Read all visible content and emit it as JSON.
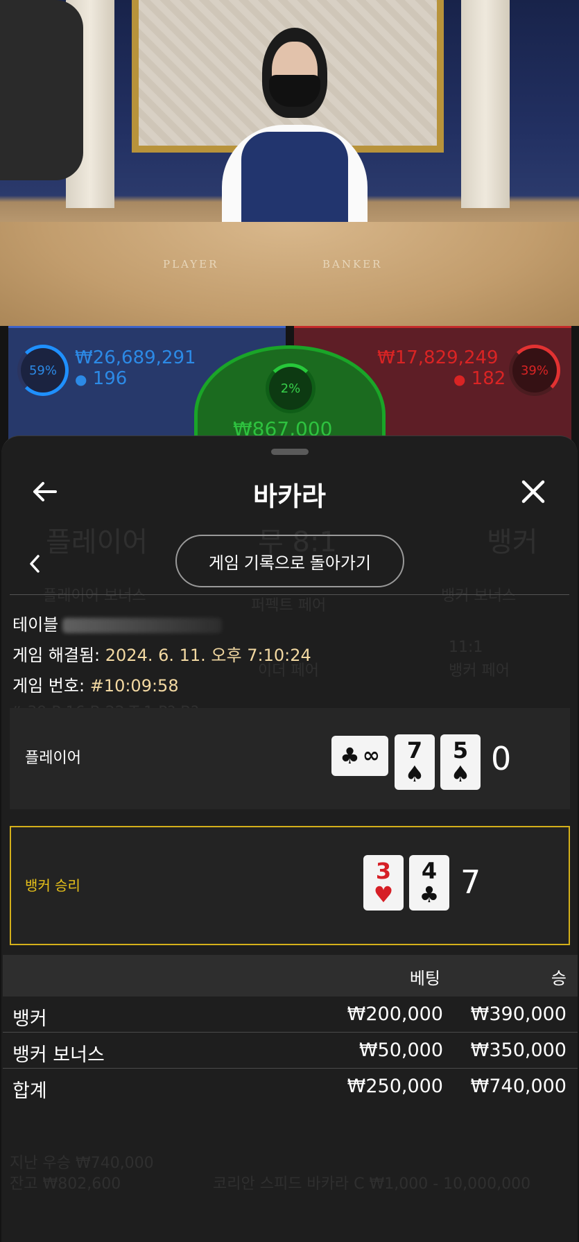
{
  "betting_strip": {
    "player": {
      "percent": "59%",
      "amount": "₩26,689,291",
      "players": "196"
    },
    "banker": {
      "percent": "39%",
      "amount": "₩17,829,249",
      "players": "182"
    },
    "tie": {
      "percent": "2%",
      "amount": "₩867,000"
    },
    "table_labels": {
      "player": "PLAYER",
      "banker": "BANKER"
    }
  },
  "header": {
    "title": "바카라",
    "back_icon": "arrow-left-icon",
    "close_icon": "close-icon"
  },
  "nav": {
    "prev_icon": "chevron-left-icon",
    "back_to_history_label": "게임 기록으로 돌아가기"
  },
  "game_info": {
    "table_label": "테이블",
    "resolved_label": "게임 해결됨:",
    "resolved_value": "2024. 6. 11. 오후 7:10:24",
    "number_label": "게임 번호:",
    "number_value": "#10:09:58"
  },
  "hands": {
    "player": {
      "label": "플레이어",
      "score": "0",
      "cards": [
        {
          "rank": "∞",
          "suit": "♣",
          "color": "black",
          "sideways": true
        },
        {
          "rank": "7",
          "suit": "♠",
          "color": "black",
          "sideways": false
        },
        {
          "rank": "5",
          "suit": "♠",
          "color": "black",
          "sideways": false
        }
      ]
    },
    "banker": {
      "label": "뱅커 승리",
      "score": "7",
      "cards": [
        {
          "rank": "3",
          "suit": "♥",
          "color": "red",
          "sideways": false
        },
        {
          "rank": "4",
          "suit": "♣",
          "color": "black",
          "sideways": false
        }
      ]
    }
  },
  "bets_table": {
    "headers": {
      "bet": "베팅",
      "win": "승"
    },
    "rows": [
      {
        "name": "뱅커",
        "bet": "₩200,000",
        "win": "₩390,000"
      },
      {
        "name": "뱅커 보너스",
        "bet": "₩50,000",
        "win": "₩350,000"
      },
      {
        "name": "합계",
        "bet": "₩250,000",
        "win": "₩740,000"
      }
    ]
  },
  "colors": {
    "accent_gold": "#d4b01a",
    "resolved_value": "#f3d9a2",
    "player_blue": "#2c8ae6",
    "banker_red": "#d92424",
    "tie_green": "#2ec23f"
  }
}
